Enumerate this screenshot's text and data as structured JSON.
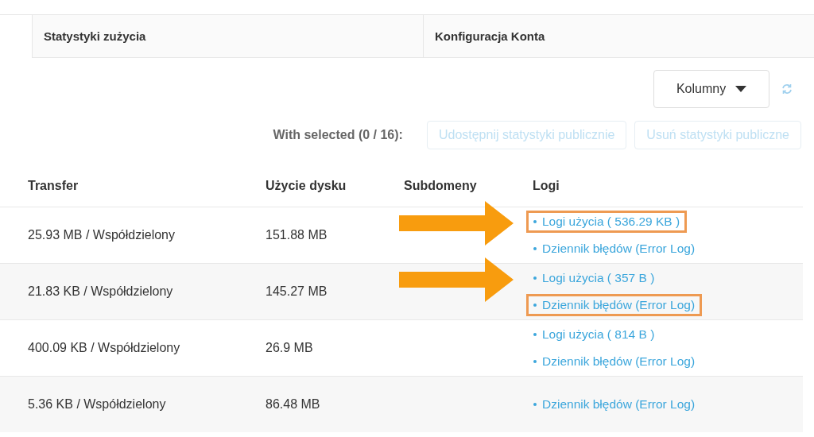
{
  "tabs": [
    {
      "label": "Statystyki zużycia",
      "selected": false
    },
    {
      "label": "Konfiguracja Konta",
      "selected": false
    }
  ],
  "columns_button": {
    "label": "Kolumny"
  },
  "bulk": {
    "label": "With selected (0 / 16):",
    "buttons": [
      {
        "label": "Udostępnij statystyki publicznie",
        "disabled": true
      },
      {
        "label": "Usuń statystyki publiczne",
        "disabled": true
      }
    ]
  },
  "table": {
    "columns": [
      "Transfer",
      "Użycie dysku",
      "Subdomeny",
      "Logi"
    ],
    "rows": [
      {
        "transfer": "25.93 MB / Współdzielony",
        "disk": "151.88 MB",
        "arrow": true,
        "logs": [
          {
            "label": "Logi użycia ( 536.29 KB )",
            "highlighted": true
          },
          {
            "label": "Dziennik błędów (Error Log)",
            "highlighted": false
          }
        ]
      },
      {
        "transfer": "21.83 KB / Współdzielony",
        "disk": "145.27 MB",
        "arrow": true,
        "logs": [
          {
            "label": "Logi użycia ( 357 B )",
            "highlighted": false
          },
          {
            "label": "Dziennik błędów (Error Log)",
            "highlighted": true
          }
        ]
      },
      {
        "transfer": "400.09 KB / Współdzielony",
        "disk": "26.9 MB",
        "arrow": false,
        "logs": [
          {
            "label": "Logi użycia ( 814 B )",
            "highlighted": false
          },
          {
            "label": "Dziennik błędów (Error Log)",
            "highlighted": false
          }
        ]
      },
      {
        "transfer": "5.36 KB / Współdzielony",
        "disk": "86.48 MB",
        "arrow": false,
        "logs": [
          {
            "label": "Dziennik błędów (Error Log)",
            "highlighted": false
          }
        ]
      }
    ]
  }
}
